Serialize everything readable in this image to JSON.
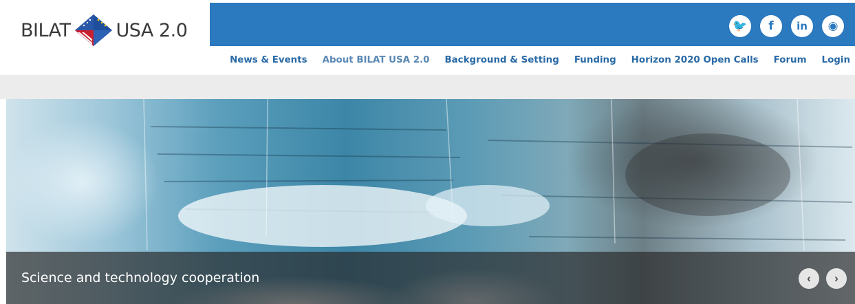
{
  "logo": {
    "left_text": "BILAT",
    "right_text": "USA 2.0"
  },
  "social": [
    {
      "name": "twitter-icon",
      "glyph": "🐦"
    },
    {
      "name": "facebook-icon",
      "glyph": "f"
    },
    {
      "name": "linkedin-icon",
      "glyph": "in"
    },
    {
      "name": "rss-icon",
      "glyph": "◉"
    }
  ],
  "nav": [
    {
      "label": "News & Events"
    },
    {
      "label": "About BILAT USA 2.0",
      "active": true
    },
    {
      "label": "Background & Setting"
    },
    {
      "label": "Funding"
    },
    {
      "label": "Horizon 2020 Open Calls"
    },
    {
      "label": "Forum"
    },
    {
      "label": "Login"
    }
  ],
  "hero": {
    "caption": "Science and technology cooperation",
    "prev_glyph": "‹",
    "next_glyph": "›"
  },
  "colors": {
    "brand_blue": "#2b79be",
    "nav_text": "#2a6aa6",
    "nav_active": "#5a88b4"
  }
}
